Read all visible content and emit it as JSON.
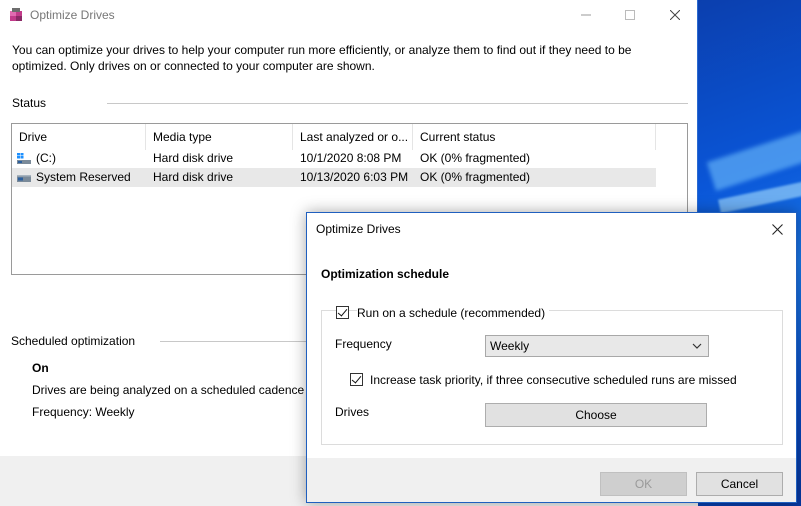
{
  "main": {
    "title": "Optimize Drives",
    "intro": "You can optimize your drives to help your computer run more efficiently, or analyze them to find out if they need to be optimized. Only drives on or connected to your computer are shown.",
    "status_label": "Status",
    "columns": [
      "Drive",
      "Media type",
      "Last analyzed or o...",
      "Current status"
    ],
    "drives": [
      {
        "drive": "(C:)",
        "media_type": "Hard disk drive",
        "last_analyzed": "10/1/2020 8:08 PM",
        "status": "OK (0% fragmented)",
        "icon": "windows-drive-icon",
        "selected": false
      },
      {
        "drive": "System Reserved",
        "media_type": "Hard disk drive",
        "last_analyzed": "10/13/2020 6:03 PM",
        "status": "OK (0% fragmented)",
        "icon": "hard-drive-icon",
        "selected": true
      }
    ],
    "scheduled_label": "Scheduled optimization",
    "schedule_state": "On",
    "schedule_description": "Drives are being analyzed on a scheduled cadence ar",
    "schedule_frequency": "Frequency: Weekly"
  },
  "dialog": {
    "title": "Optimize Drives",
    "heading": "Optimization schedule",
    "run_on_schedule_label": "Run on a schedule (recommended)",
    "run_on_schedule_checked": true,
    "frequency_label": "Frequency",
    "frequency_value": "Weekly",
    "increase_priority_label": "Increase task priority, if three consecutive scheduled runs are missed",
    "increase_priority_checked": true,
    "drives_label": "Drives",
    "choose_label": "Choose",
    "ok_label": "OK",
    "cancel_label": "Cancel"
  },
  "colors": {
    "accent": "#1f5fbf",
    "selected_row": "#e8e8e8",
    "dialog_bg": "#f0f0f0"
  }
}
